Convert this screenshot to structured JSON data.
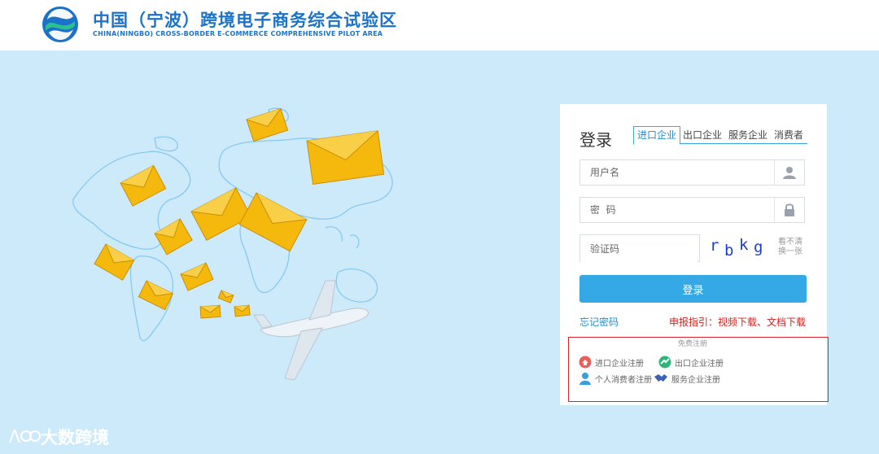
{
  "header": {
    "title_cn": "中国（宁波）跨境电子商务综合试验区",
    "title_en": "CHINA(NINGBO) CROSS-BORDER E-COMMERCE  COMPREHENSIVE PILOT AREA"
  },
  "login": {
    "title": "登录",
    "tabs": [
      {
        "label": "进口企业",
        "active": true
      },
      {
        "label": "出口企业",
        "active": false
      },
      {
        "label": "服务企业",
        "active": false
      },
      {
        "label": "消费者",
        "active": false
      }
    ],
    "username_placeholder": "用户名",
    "password_placeholder": "密  码",
    "captcha_placeholder": "验证码",
    "captcha_chars": [
      "r",
      "b",
      "k",
      "g"
    ],
    "refresh_line1": "看不清",
    "refresh_line2": "换一张",
    "submit_label": "登录",
    "forgot_label": "忘记密码",
    "guide_prefix": "申报指引：",
    "guide_video": "视频下载",
    "guide_sep": "、",
    "guide_doc": "文档下载"
  },
  "register": {
    "title": "免费注册",
    "items": [
      {
        "label": "进口企业注册",
        "icon": "import-company-icon"
      },
      {
        "label": "出口企业注册",
        "icon": "export-company-icon"
      },
      {
        "label": "个人消费者注册",
        "icon": "consumer-icon"
      },
      {
        "label": "服务企业注册",
        "icon": "handshake-icon"
      }
    ]
  },
  "watermark": "大数跨境",
  "colors": {
    "brand_blue": "#1a73c8",
    "accent": "#35a8e6",
    "hero_bg": "#cdeafa",
    "envelope": "#f5b90e",
    "alert_red": "#d0201c"
  }
}
